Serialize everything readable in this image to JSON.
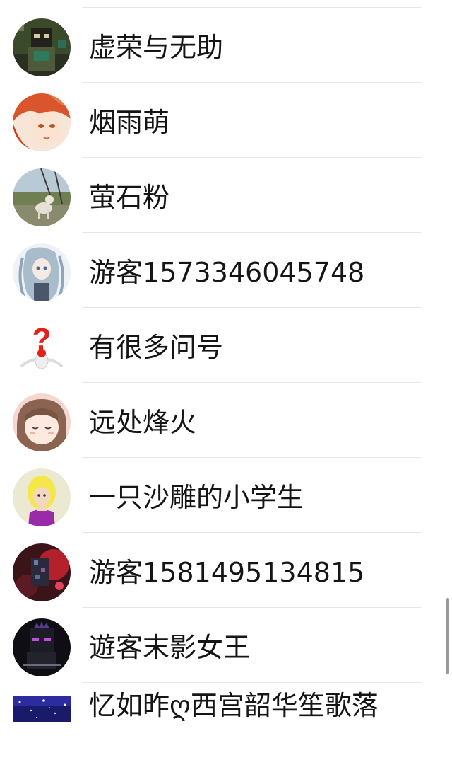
{
  "users": [
    {
      "name": "虚荣与无助",
      "avatar_icon": "dark-pixel-character-avatar-icon"
    },
    {
      "name": "烟雨萌",
      "avatar_icon": "anime-red-hair-avatar-icon"
    },
    {
      "name": "萤石粉",
      "avatar_icon": "dog-outdoor-photo-avatar-icon"
    },
    {
      "name": "游客1573346045748",
      "avatar_icon": "anime-silver-hair-avatar-icon"
    },
    {
      "name": "有很多问号",
      "avatar_icon": "question-mark-person-avatar-icon"
    },
    {
      "name": "远处烽火",
      "avatar_icon": "anime-girl-brown-hair-avatar-icon"
    },
    {
      "name": "一只沙雕的小学生",
      "avatar_icon": "yellow-hair-purple-shirt-avatar-icon"
    },
    {
      "name": "游客1581495134815",
      "avatar_icon": "dark-red-artwork-avatar-icon"
    },
    {
      "name": "遊客末影女王",
      "avatar_icon": "enderman-queen-avatar-icon"
    },
    {
      "name": "忆如昨ღ西宫韶华笙歌落",
      "avatar_icon": "starry-night-avatar-icon"
    }
  ],
  "colors": {
    "text": "#151515",
    "divider": "#e6e6e6",
    "scrollbar": "#9a9a9a"
  }
}
